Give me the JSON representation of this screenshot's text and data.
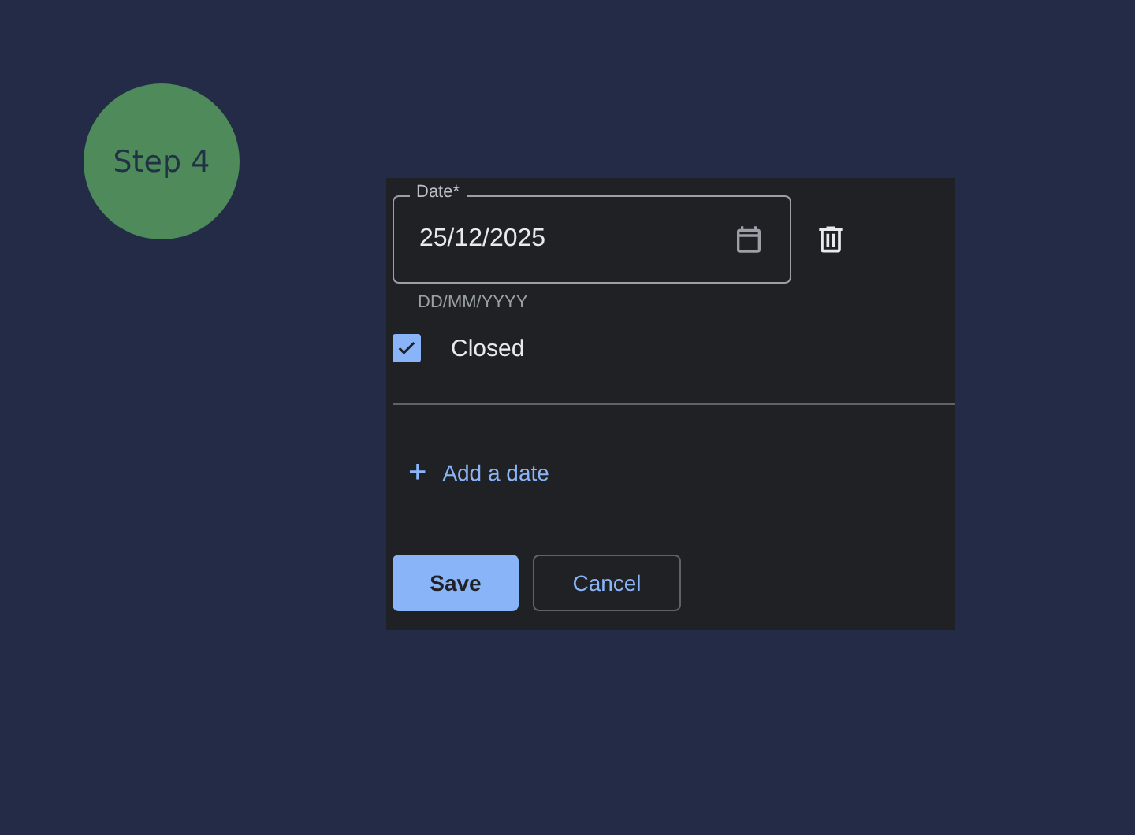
{
  "step_badge": "Step 4",
  "date_field": {
    "label": "Date*",
    "value": "25/12/2025",
    "helper": "DD/MM/YYYY"
  },
  "closed_checkbox": {
    "label": "Closed",
    "checked": true
  },
  "add_link": {
    "icon": "+",
    "label": "Add a date"
  },
  "buttons": [
    {
      "kind": "primary",
      "label": "Save"
    },
    {
      "kind": "outline",
      "label": "Cancel"
    }
  ]
}
